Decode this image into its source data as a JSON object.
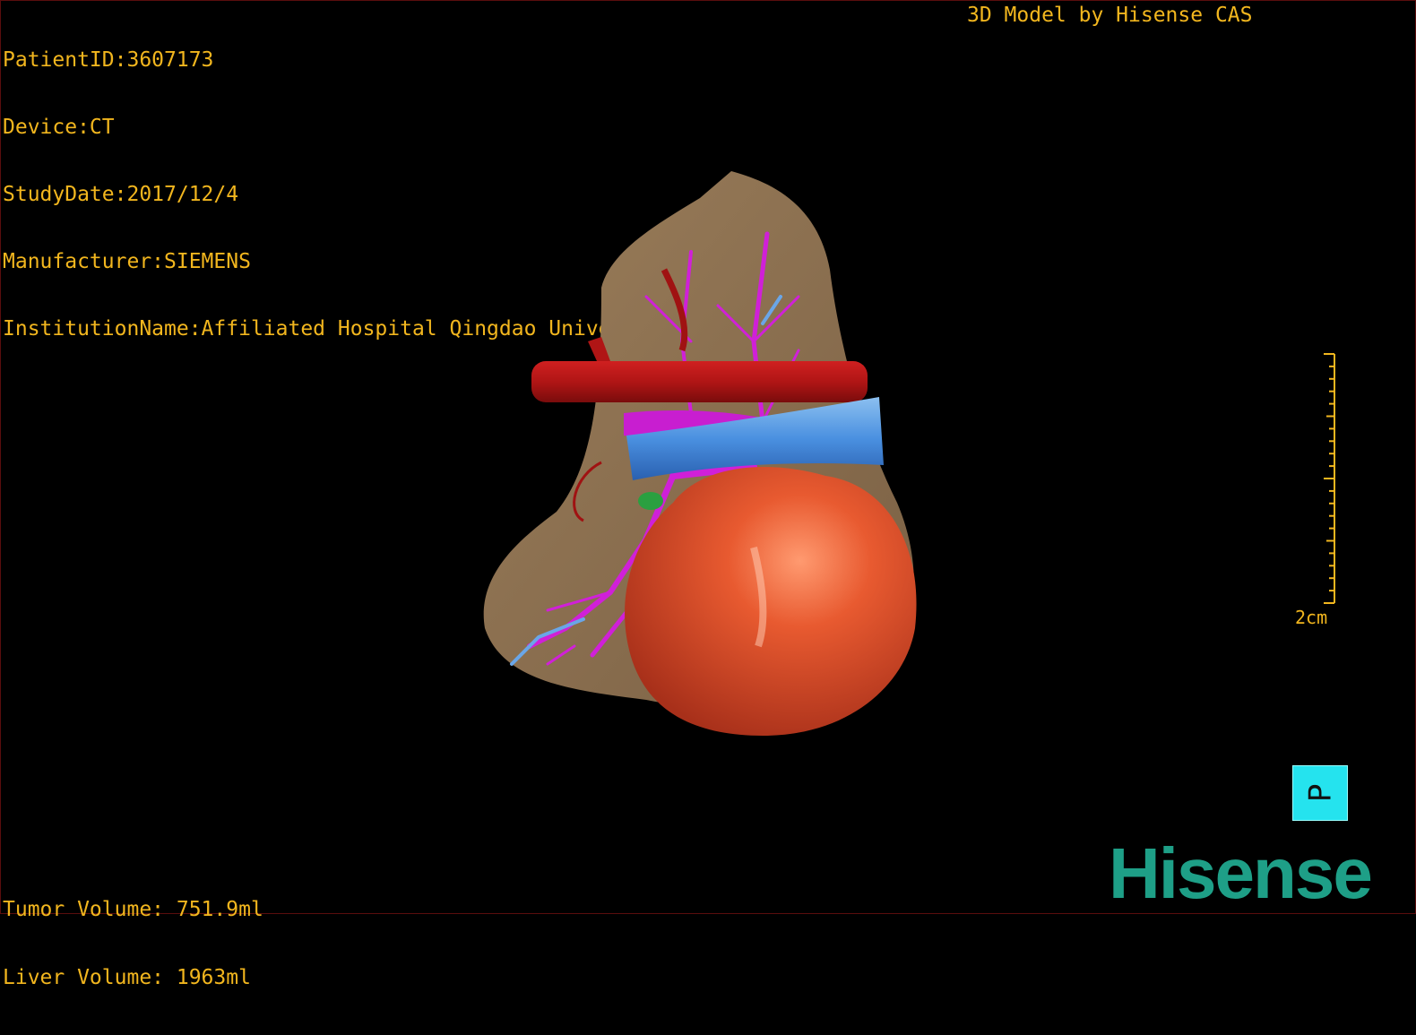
{
  "header": {
    "patient_id": "PatientID:3607173",
    "device": "Device:CT",
    "study_date": "StudyDate:2017/12/4",
    "manufacturer": "Manufacturer:SIEMENS",
    "institution": "InstitutionName:Affiliated Hospital Qingdao University-C",
    "model_credit": "3D Model by Hisense CAS"
  },
  "footer": {
    "tumor_volume": "Tumor Volume: 751.9ml",
    "liver_volume": "Liver Volume: 1963ml"
  },
  "scale": {
    "label": "2cm"
  },
  "orientation": {
    "label": "P"
  },
  "brand": {
    "logo_text": "Hisense"
  },
  "colors": {
    "overlay_text": "#f2b61e",
    "liver": "#8a7050",
    "tumor": "#e0532e",
    "artery": "#b81414",
    "vein": "#4a90e0",
    "portal_vein": "#d020d8",
    "orientation_cube": "#25e3ee",
    "brand": "#1e9f87"
  }
}
